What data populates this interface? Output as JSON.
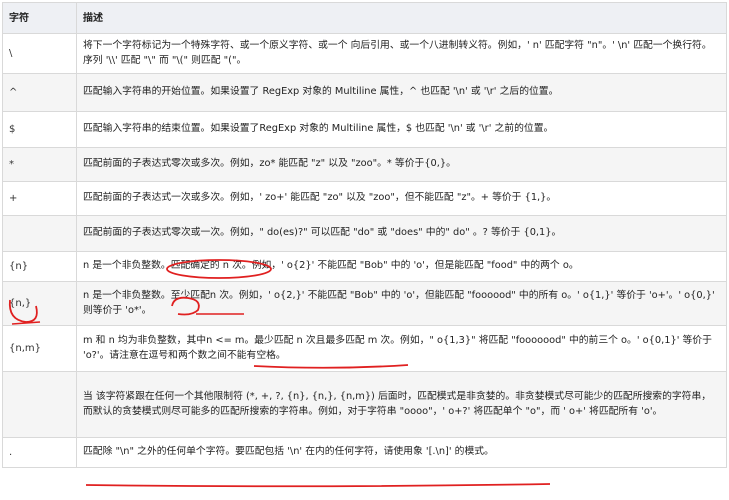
{
  "table": {
    "headers": [
      "字符",
      "描述"
    ],
    "rows": [
      {
        "char": "\\",
        "desc": "将下一个字符标记为一个特殊字符、或一个原义字符、或一个 向后引用、或一个八进制转义符。例如，' n' 匹配字符 \"n\"。' \\n' 匹配一个换行符。序列 '\\\\' 匹配 \"\\\" 而 \"\\(\" 则匹配 \"(\"。"
      },
      {
        "char": "^",
        "desc": "匹配输入字符串的开始位置。如果设置了 RegExp 对象的 Multiline 属性，^ 也匹配 '\\n' 或 '\\r' 之后的位置。"
      },
      {
        "char": "$",
        "desc": "匹配输入字符串的结束位置。如果设置了RegExp 对象的 Multiline 属性，$ 也匹配 '\\n' 或 '\\r' 之前的位置。"
      },
      {
        "char": "*",
        "desc": "匹配前面的子表达式零次或多次。例如，zo* 能匹配 \"z\" 以及 \"zoo\"。* 等价于{0,}。"
      },
      {
        "char": "+",
        "desc": "匹配前面的子表达式一次或多次。例如，' zo+' 能匹配 \"zo\" 以及 \"zoo\"，但不能匹配 \"z\"。+ 等价于 {1,}。"
      },
      {
        "char": "",
        "desc": "匹配前面的子表达式零次或一次。例如，\" do(es)?\" 可以匹配 \"do\" 或 \"does\" 中的\" do\" 。? 等价于 {0,1}。"
      },
      {
        "char": "{n}",
        "desc": "n 是一个非负整数。匹配确定的 n 次。例如，' o{2}' 不能匹配 \"Bob\" 中的 'o'，但是能匹配 \"food\" 中的两个 o。"
      },
      {
        "char": "{n,}",
        "desc": "n 是一个非负整数。至少匹配n 次。例如，' o{2,}' 不能匹配 \"Bob\" 中的 'o'，但能匹配 \"foooood\" 中的所有 o。' o{1,}' 等价于 'o+'。' o{0,}' 则等价于 'o*'。"
      },
      {
        "char": "{n,m}",
        "desc": "m 和 n 均为非负整数，其中n <= m。最少匹配 n 次且最多匹配 m 次。例如，\" o{1,3}\" 将匹配 \"fooooood\" 中的前三个 o。' o{0,1}' 等价于 'o?'。请注意在逗号和两个数之间不能有空格。"
      },
      {
        "char": "",
        "desc": "当 该字符紧跟在任何一个其他限制符 (*, +, ?, {n}, {n,}, {n,m}) 后面时，匹配模式是非贪婪的。非贪婪模式尽可能少的匹配所搜索的字符串，而默认的贪婪模式则尽可能多的匹配所搜索的字符串。例如，对于字符串 \"oooo\"，' o+?' 将匹配单个 \"o\"，而 ' o+' 将匹配所有 'o'。"
      },
      {
        "char": ".",
        "desc": "匹配除 \"\\n\" 之外的任何单个字符。要匹配包括 '\\n' 在内的任何字符，请使用象 '[.\\n]' 的模式。"
      }
    ]
  },
  "annotation_color": "#e02020"
}
